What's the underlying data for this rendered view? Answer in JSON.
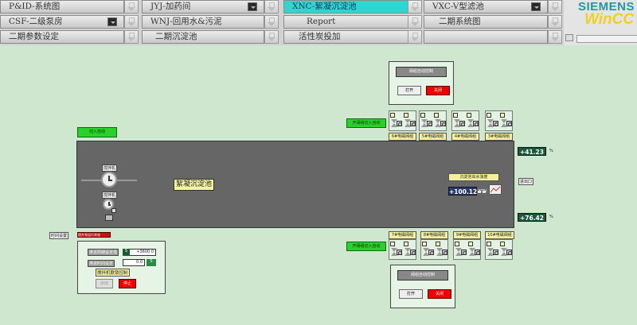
{
  "nav": {
    "row1": [
      "P&ID-系统图",
      "JYJ-加药间",
      "XNC-絮凝沉淀池",
      "VXC-V型滤池"
    ],
    "row2": [
      "CSF-二级泵房",
      "WNJ-回用水&污泥",
      "Report",
      "二期系统图"
    ],
    "row3": [
      "二期参数设定",
      "二期沉淀池",
      "活性炭投加",
      ""
    ]
  },
  "logo": {
    "brand": "SIEMENS",
    "product": "WinCC"
  },
  "control": {
    "title": "阀组自动控制",
    "open": "打开",
    "close": "关闭"
  },
  "labels": {
    "switch_auto": "切入自动",
    "top_valve_auto": "开阀组切入自动",
    "bottom_valve_auto": "开阀组切入自动",
    "mixer1": "搅拌机",
    "mixer2": "搅拌机",
    "tank_name": "絮凝沉淀池",
    "turbidity_label": "沉淀池出水浊度",
    "ntu": "NTU",
    "side_label": "进出口",
    "left_small": "时间设置",
    "red_strip": "",
    "lift_status": "提升泵运行状态",
    "param1_label": "排泥周期设定值",
    "param2_label": "排泥时间设定",
    "param1_value": "+3600.0",
    "param2_value": "0.0",
    "param2_unit": "S",
    "param1_unit": "S",
    "mixer_link": "搅拌机联锁控制",
    "start": "启动",
    "stop": "停止"
  },
  "top_valves": [
    {
      "label": "6#电磁阀组"
    },
    {
      "label": "5#电磁阀组"
    },
    {
      "label": "4#电磁阀组"
    },
    {
      "label": "3#电磁阀组"
    }
  ],
  "bottom_valves": [
    {
      "label": "7#电磁阀组"
    },
    {
      "label": "8#电磁阀组"
    },
    {
      "label": "9#电磁阀组"
    },
    {
      "label": "10#电磁阀组"
    }
  ],
  "values": {
    "turbidity": "+100.12",
    "level_top": "+41.23",
    "level_bottom": "+76.42",
    "percent": "%"
  },
  "colors": {
    "green": "#2bd12b",
    "red": "#f00000",
    "accent": "#2fd5cf",
    "tank": "#666666"
  }
}
